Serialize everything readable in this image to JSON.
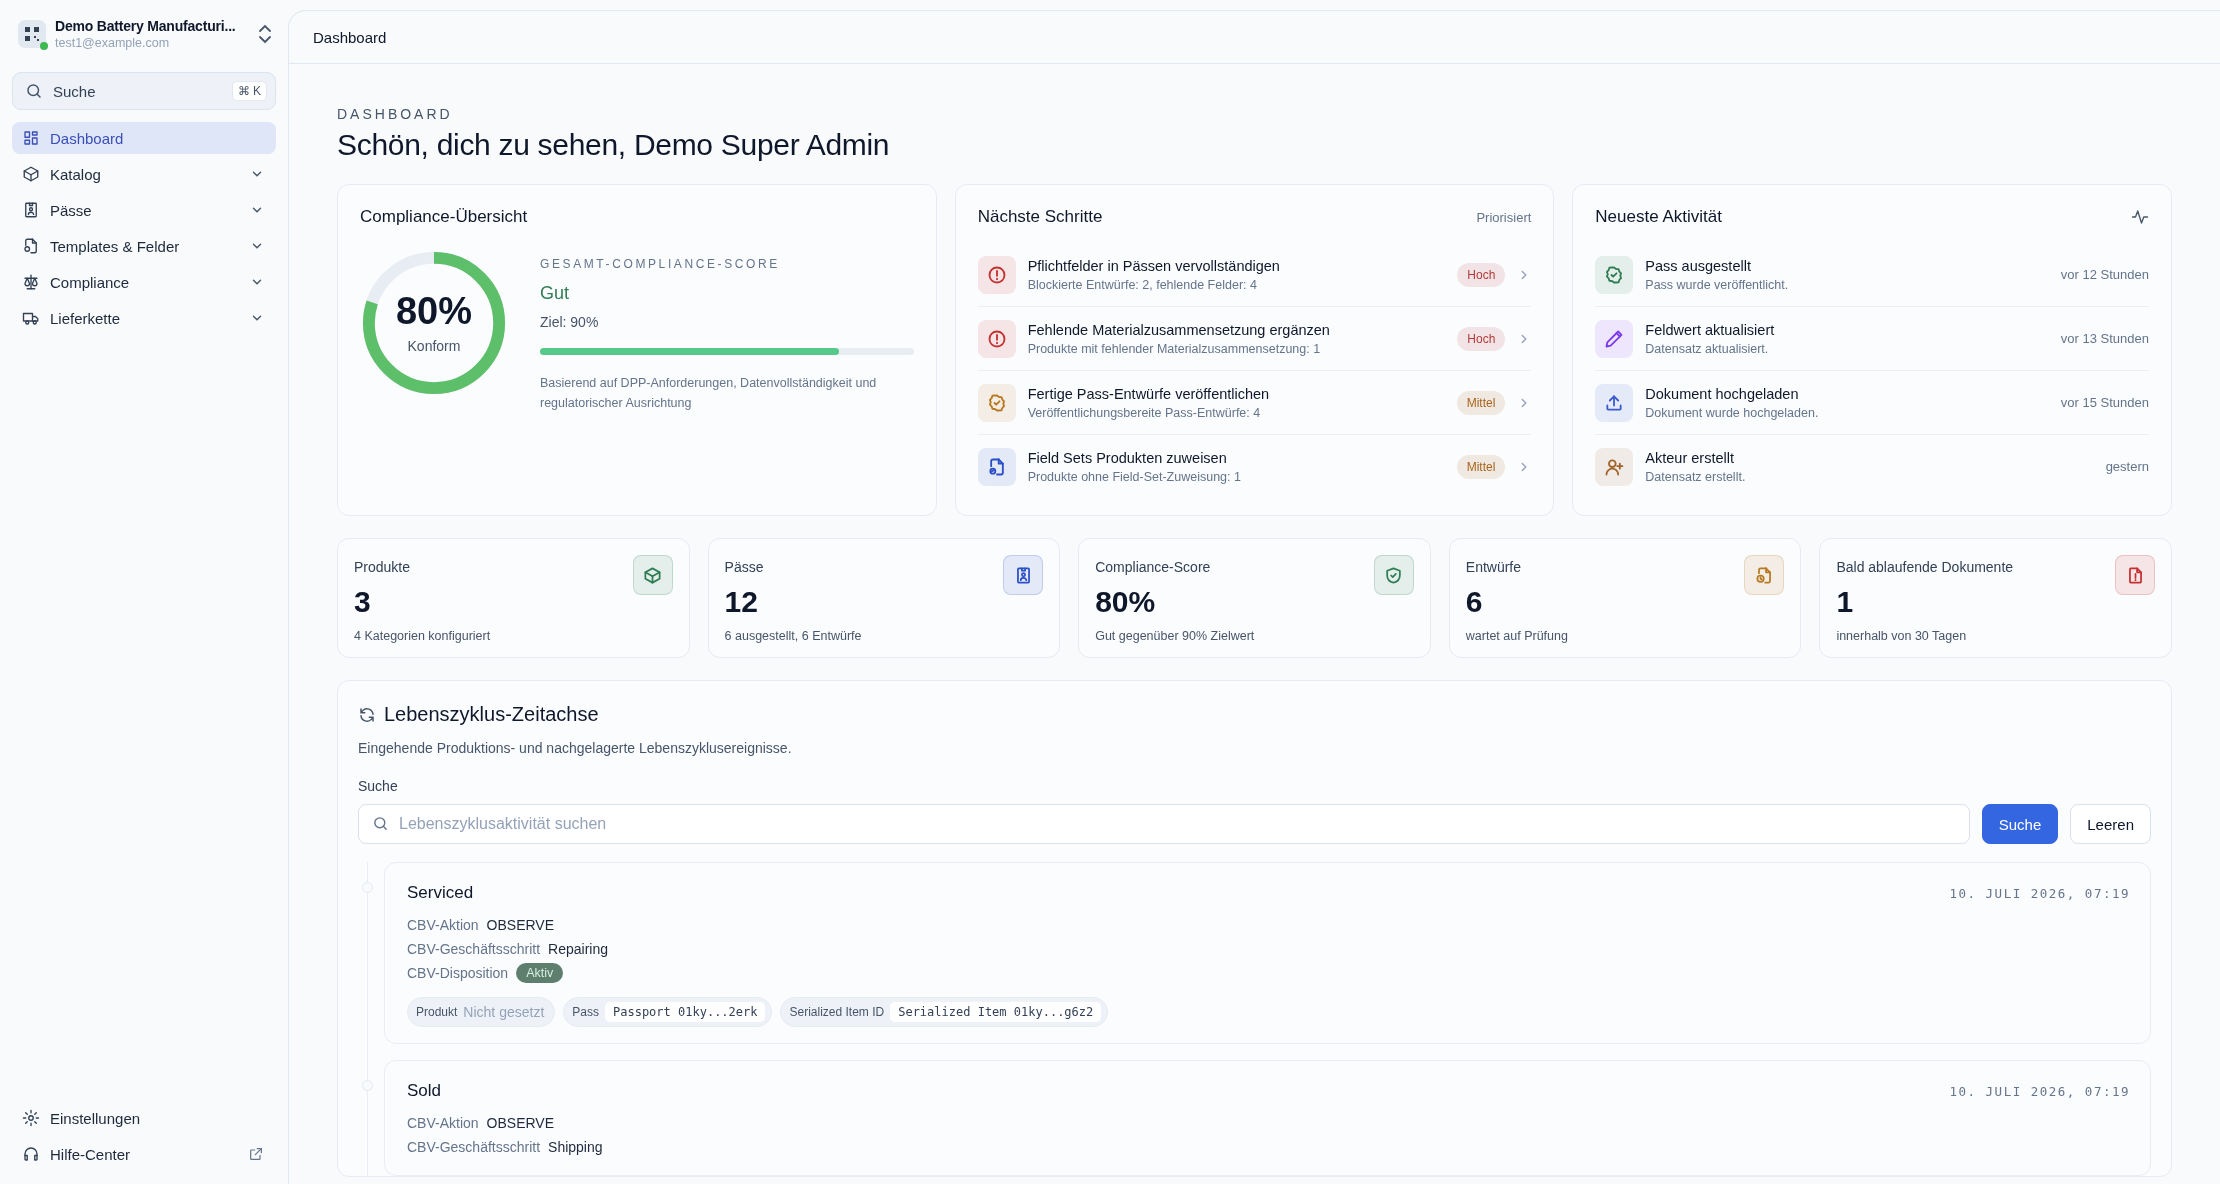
{
  "org": {
    "name": "Demo Battery Manufacturi...",
    "email": "test1@example.com",
    "online": true
  },
  "sidebar_search": {
    "placeholder": "Suche",
    "shortcut": "⌘ K"
  },
  "nav": [
    {
      "label": "Dashboard",
      "kind": "grid",
      "selected": true,
      "submenu": false
    },
    {
      "label": "Katalog",
      "kind": "box",
      "selected": false,
      "submenu": true
    },
    {
      "label": "Pässe",
      "kind": "idcard",
      "selected": false,
      "submenu": true
    },
    {
      "label": "Templates & Felder",
      "kind": "filecog",
      "selected": false,
      "submenu": true
    },
    {
      "label": "Compliance",
      "kind": "scale",
      "selected": false,
      "submenu": true
    },
    {
      "label": "Lieferkette",
      "kind": "truck",
      "selected": false,
      "submenu": true
    }
  ],
  "nav_footer": [
    {
      "label": "Einstellungen",
      "kind": "gear",
      "external": false
    },
    {
      "label": "Hilfe-Center",
      "kind": "headset",
      "external": true
    }
  ],
  "header": {
    "title": "Dashboard"
  },
  "eyebrow": "DASHBOARD",
  "greeting": "Schön, dich zu sehen, Demo Super Admin",
  "compliance": {
    "title": "Compliance-Übersicht",
    "level": 0.8,
    "percent": "80%",
    "status": "Konform",
    "score_label": "GESAMT-COMPLIANCE-SCORE",
    "rating": "Gut",
    "target": "Ziel: 90%",
    "progress": {
      "level": 0.8
    },
    "note": "Basierend auf DPP-Anforderungen, Datenvollständigkeit und regulatorischer Ausrichtung"
  },
  "next_steps": {
    "title": "Nächste Schritte",
    "tag": "Priorisiert",
    "items": [
      {
        "title": "Pflichtfelder in Pässen vervollständigen",
        "detail": "Blockierte Entwürfe: 2, fehlende Felder: 4",
        "priority": {
          "label": "Hoch",
          "color": "#b33a3a"
        },
        "kind": "alert",
        "color": "#c53030"
      },
      {
        "title": "Fehlende Materialzusammensetzung ergänzen",
        "detail": "Produkte mit fehlender Materialzusammensetzung: 1",
        "priority": {
          "label": "Hoch",
          "color": "#b33a3a"
        },
        "kind": "alert",
        "color": "#c53030"
      },
      {
        "title": "Fertige Pass-Entwürfe veröffentlichen",
        "detail": "Veröffentlichungsbereite Pass-Entwürfe: 4",
        "priority": {
          "label": "Mittel",
          "color": "#a8641c"
        },
        "kind": "badgecheck",
        "color": "#b7791f"
      },
      {
        "title": "Field Sets Produkten zuweisen",
        "detail": "Produkte ohne Field-Set-Zuweisung: 1",
        "priority": {
          "label": "Mittel",
          "color": "#a8641c"
        },
        "kind": "filecircle",
        "color": "#2b4fc7"
      }
    ]
  },
  "activity": {
    "title": "Neueste Aktivität",
    "items": [
      {
        "title": "Pass ausgestellt",
        "detail": "Pass wurde veröffentlicht.",
        "time": "vor 12 Stunden",
        "kind": "badgecheck",
        "color": "#2f7d52"
      },
      {
        "title": "Feldwert aktualisiert",
        "detail": "Datensatz aktualisiert.",
        "time": "vor 13 Stunden",
        "kind": "pencil",
        "color": "#7c3aed"
      },
      {
        "title": "Dokument hochgeladen",
        "detail": "Dokument wurde hochgeladen.",
        "time": "vor 15 Stunden",
        "kind": "upload",
        "color": "#3b5bcc"
      },
      {
        "title": "Akteur erstellt",
        "detail": "Datensatz erstellt.",
        "time": "gestern",
        "kind": "userplus",
        "color": "#a0652a"
      }
    ]
  },
  "stats": [
    {
      "label": "Produkte",
      "value": "3",
      "note": "4 Kategorien konfiguriert",
      "kind": "box",
      "color": "#2f7d52"
    },
    {
      "label": "Pässe",
      "value": "12",
      "note": "6 ausgestellt, 6 Entwürfe",
      "kind": "idcard",
      "color": "#2b4fc7"
    },
    {
      "label": "Compliance-Score",
      "value": "80%",
      "note": "Gut gegenüber 90% Zielwert",
      "kind": "shield",
      "color": "#2f7d52"
    },
    {
      "label": "Entwürfe",
      "value": "6",
      "note": "wartet auf Prüfung",
      "kind": "fileclock",
      "color": "#b7791f"
    },
    {
      "label": "Bald ablaufende Dokumente",
      "value": "1",
      "note": "innerhalb von 30 Tagen",
      "kind": "filealert",
      "color": "#c53030"
    }
  ],
  "timeline": {
    "title": "Lebenszyklus-Zeitachse",
    "subtitle": "Eingehende Produktions- und nachgelagerte Lebenszyklusereignisse.",
    "search_label": "Suche",
    "placeholder": "Lebenszyklusaktivität suchen",
    "buttons": [
      {
        "label": "Suche",
        "kind": "primary"
      },
      {
        "label": "Leeren",
        "kind": "secondary"
      }
    ],
    "events": [
      {
        "title": "Serviced",
        "date": "10. JULI 2026, 07:19",
        "fields": [
          {
            "label": "CBV-Aktion",
            "value": "OBSERVE",
            "kind": "text"
          },
          {
            "label": "CBV-Geschäftsschritt",
            "value": "Repairing",
            "kind": "text"
          },
          {
            "label": "CBV-Disposition",
            "value": "Aktiv",
            "kind": "badge"
          }
        ],
        "refs": [
          {
            "label": "Produkt",
            "value": "Nicht gesetzt",
            "kind": "unset"
          },
          {
            "label": "Pass",
            "value": "Passport 01ky...2erk",
            "kind": "code"
          },
          {
            "label": "Serialized Item ID",
            "value": "Serialized Item 01ky...g6z2",
            "kind": "code"
          }
        ]
      },
      {
        "title": "Sold",
        "date": "10. JULI 2026, 07:19",
        "fields": [
          {
            "label": "CBV-Aktion",
            "value": "OBSERVE",
            "kind": "text"
          },
          {
            "label": "CBV-Geschäftsschritt",
            "value": "Shipping",
            "kind": "text"
          }
        ]
      }
    ]
  }
}
